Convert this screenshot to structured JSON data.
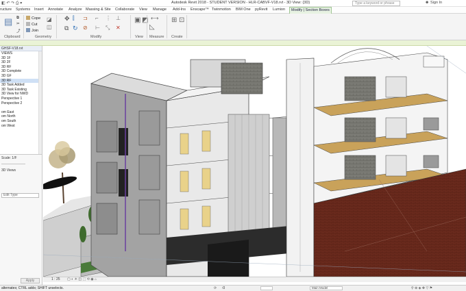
{
  "titlebar": {
    "title": "Autodesk Revit 2018 - STUDENT VERSION -   HLR-CABVF-V18.rvt - 3D View: {3D}",
    "search_placeholder": "Type a keyword or phrase",
    "sign_in": "Sign In"
  },
  "tabs": [
    "ructure",
    "Systems",
    "Insert",
    "Annotate",
    "Analyze",
    "Massing & Site",
    "Collaborate",
    "View",
    "Manage",
    "Add-Ins",
    "Enscape™",
    "Twinmotion",
    "BIM One",
    "pyRevit",
    "Lumion",
    "Modify | Section Boxes"
  ],
  "ribbon": {
    "clipboard": "Clipboard",
    "geometry": "Geometry",
    "modify": "Modify",
    "view": "View",
    "measure": "Measure",
    "create": "Create",
    "cope": "Cope",
    "cut": "Cut",
    "join": "Join"
  },
  "browser": {
    "header": "GHSF-V18.rvt",
    "items": [
      "VIEWS",
      "3D 1F",
      "3D 2F",
      "3D RF",
      "3D Complete",
      "3D GF",
      "3D RF",
      "3D Task Added",
      "3D Task Existing",
      "3D View for NWD",
      "Perspective 1",
      "Perspective 2",
      "",
      "om East",
      "om North",
      "om South",
      "om West"
    ],
    "selected": 6
  },
  "properties": {
    "scale": "Scale: 1/F",
    "dropdown": "3D Views",
    "edit_type": "Edit Type",
    "apply": "Apply"
  },
  "view_controls": {
    "scale": "1 : 25"
  },
  "status": {
    "hint": "alternates; CTRL adds; SHIFT unselects.",
    "model": "Main Model",
    "zero": ":0"
  },
  "colors": {
    "ribbon_active": "#e7f2e2",
    "green_bar": "#eaf3d6",
    "selection": "#cfe0f5",
    "wall_gray": "#8a8a8a",
    "floor_wood": "#c9a25a",
    "window_yellow": "#e9d28a",
    "tree_green": "#3f6b2e",
    "brick_red": "#6e2b1e"
  }
}
